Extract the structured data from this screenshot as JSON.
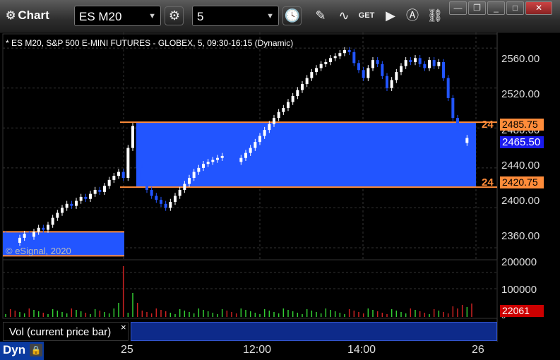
{
  "window": {
    "title": "Chart",
    "symbol": "ES M20",
    "interval": "5"
  },
  "chart_header": "* ES M20, S&P 500 E-MINI FUTURES - GLOBEX, 5, 09:30-16:15 (Dynamic)",
  "watermark": "© eSignal, 2020",
  "price_axis": [
    "2560.00",
    "2520.00",
    "2480.00",
    "2440.00",
    "2400.00",
    "2360.00"
  ],
  "volume_axis": [
    "200000",
    "100000",
    "0"
  ],
  "price_markers": {
    "upper": "2485.75",
    "upper_prefix": "24",
    "last": "2465.50",
    "lower": "2420.75",
    "lower_prefix": "24"
  },
  "volume_marker": "22061",
  "volume_pane": {
    "label": "Vol (current price bar)",
    "close": "×"
  },
  "time_axis": [
    "25",
    "12:00",
    "14:00",
    "26"
  ],
  "bottom": {
    "mode": "Dyn",
    "lock_icon": "lock-icon"
  },
  "colors": {
    "zone_fill": "#2255ff",
    "zone_line": "#ff8c3a",
    "last_price_bg": "#1a1aee",
    "volume_marker_bg": "#cc0000",
    "candle_up": "#ffffff",
    "candle_down": "#2255ff"
  },
  "chart_data": {
    "type": "candlestick",
    "title": "ES M20, S&P 500 E-MINI FUTURES - GLOBEX, 5, 09:30-16:15 (Dynamic)",
    "ylim": [
      2348,
      2570
    ],
    "zones": [
      {
        "top": 2485.75,
        "bottom": 2420.75,
        "session": "25"
      },
      {
        "top": 2376,
        "bottom": 2352,
        "session": "24"
      }
    ],
    "close_series": [
      2372,
      2368,
      2365,
      2370,
      2374,
      2371,
      2376,
      2380,
      2378,
      2383,
      2390,
      2395,
      2400,
      2404,
      2402,
      2407,
      2411,
      2409,
      2414,
      2418,
      2416,
      2422,
      2428,
      2432,
      2436,
      2430,
      2460,
      2482,
      2440,
      2428,
      2418,
      2412,
      2408,
      2404,
      2400,
      2406,
      2412,
      2418,
      2424,
      2430,
      2436,
      2440,
      2444,
      2446,
      2448,
      2450,
      2452,
      2450,
      2448,
      2446,
      2450,
      2455,
      2460,
      2466,
      2472,
      2478,
      2484,
      2490,
      2496,
      2500,
      2506,
      2512,
      2518,
      2524,
      2530,
      2536,
      2540,
      2544,
      2546,
      2550,
      2552,
      2555,
      2558,
      2556,
      2545,
      2538,
      2530,
      2540,
      2548,
      2544,
      2532,
      2520,
      2528,
      2536,
      2542,
      2548,
      2546,
      2550,
      2544,
      2540,
      2548,
      2542,
      2546,
      2530,
      2510,
      2490,
      2478,
      2465,
      2470,
      2465
    ],
    "volume_note": "Volume bars shown below; spike near session open of day 25."
  }
}
